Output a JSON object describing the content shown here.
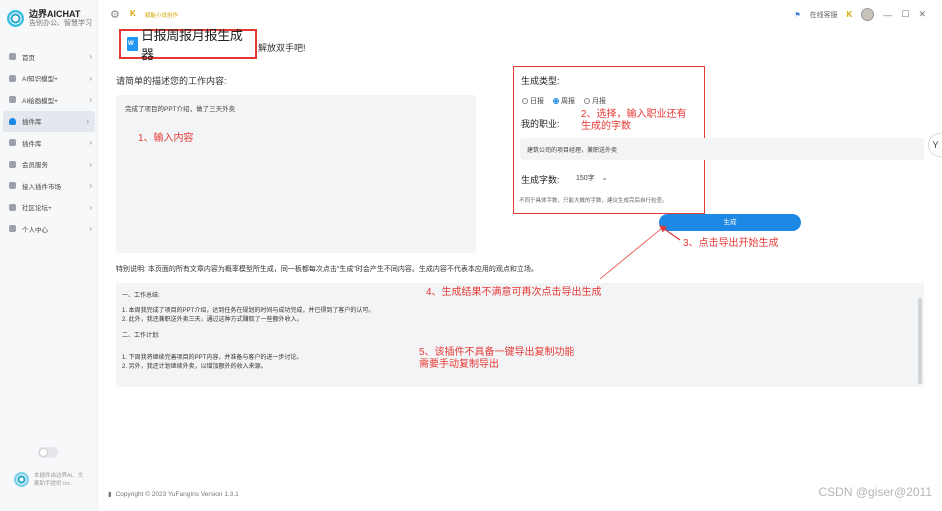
{
  "app": {
    "name": "边界AICHAT",
    "tagline": "告别办公、智慧学习"
  },
  "sidebar": {
    "items": [
      {
        "label": "首页"
      },
      {
        "label": "AI知识模型+"
      },
      {
        "label": "AI绘画模型+"
      },
      {
        "label": "插件库"
      },
      {
        "label": "插件库"
      },
      {
        "label": "会员服务"
      },
      {
        "label": "接入插件市场"
      },
      {
        "label": "社区论坛+"
      },
      {
        "label": "个人中心"
      }
    ],
    "footer_text": "本插件由边界AI、文案助手提供 Inc."
  },
  "topbar": {
    "brand_glyph": "K",
    "brand_text": "赋能小说创作",
    "right_label": "在线客服",
    "minimize": "—",
    "maximize": "☐",
    "close": "✕"
  },
  "tool": {
    "title": "日报周报月报生成器",
    "subtitle": "解放双手吧!",
    "desc_label": "请简单的描述您的工作内容:",
    "desc_value": "完成了项目的PPT介绍，做了三天外卖",
    "type_label": "生成类型:",
    "types": [
      {
        "label": "日报",
        "checked": false
      },
      {
        "label": "周报",
        "checked": true
      },
      {
        "label": "月报",
        "checked": false
      }
    ],
    "job_label": "我的职业:",
    "job_value": "建筑公司的项目经理，兼职送外卖",
    "count_label": "生成字数:",
    "count_value": "150字",
    "hint": "不同于具体字数，只能大概的字数，建议生成完后自行检查。",
    "generate_button": "生成",
    "disclaimer": "特别说明: 本页面的所有文章内容为概率模型所生成，同一板都每次点击\"生成\"时会产生不同内容。生成内容不代表本应用的观点和立场。"
  },
  "result": {
    "sections": [
      {
        "heading": "一、工作总结:",
        "lines": [
          "1. 本周我完成了项目的PPT介绍，达到任务在规划的时间与成功完成，并已得到了客户的认可。",
          "2. 此外，我还兼职送外卖三天，通过这种方式赚取了一些额外收入。"
        ]
      },
      {
        "heading": "二、工作计划:",
        "lines": [
          "1. 下周我将继续完善项目的PPT内容，并准备与客户的进一步讨论。",
          "2. 另外，我还计划继续外卖，以增加额外的收入来源。"
        ]
      }
    ]
  },
  "annotations": {
    "n1": "1、输入内容",
    "n2": "2、选择，输入职业还有\n生成的字数",
    "n3": "3、点击导出开始生成",
    "n4": "4、生成结果不满意可再次点击导出生成",
    "n5": "5、该插件不具备一键导出复制功能\n需要手动复制导出"
  },
  "footer": {
    "text": "Copyright © 2023 YuFangIns Version 1.3.1",
    "watermark": "CSDN @giser@2011"
  },
  "colors": {
    "accent": "#1e88e5",
    "annotation_red": "#e53935",
    "brand_gold": "#d9a400"
  }
}
